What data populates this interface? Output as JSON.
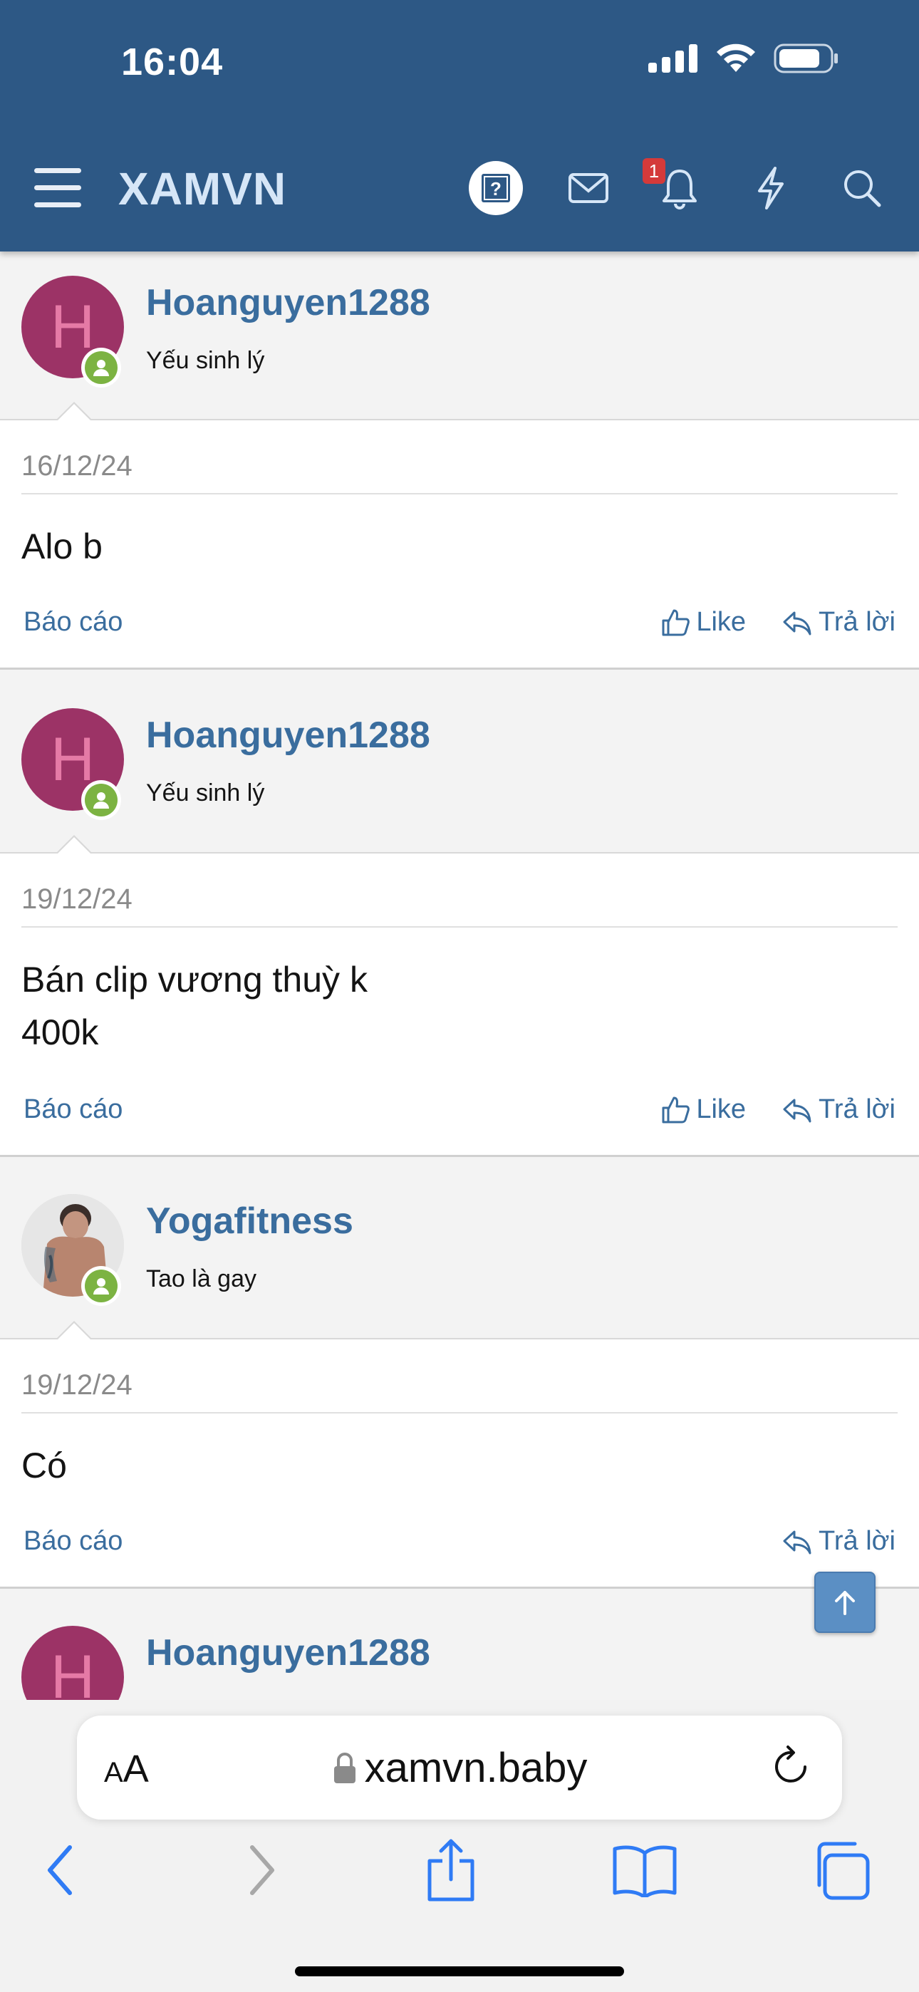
{
  "status_bar": {
    "time": "16:04"
  },
  "header": {
    "logo": "XAMVN",
    "notification_count": "1",
    "icons": [
      "menu-icon",
      "help-icon",
      "mail-icon",
      "bell-icon",
      "lightning-icon",
      "search-icon"
    ]
  },
  "posts": [
    {
      "username": "Hoanguyen1288",
      "user_title": "Yếu sinh lý",
      "avatar_letter": "H",
      "date": "16/12/24",
      "content_lines": [
        "Alo b"
      ],
      "report_label": "Báo cáo",
      "like_label": "Like",
      "reply_label": "Trả lời"
    },
    {
      "username": "Hoanguyen1288",
      "user_title": "Yếu sinh lý",
      "avatar_letter": "H",
      "date": "19/12/24",
      "content_lines": [
        "Bán clip vương thuỳ k",
        "400k"
      ],
      "report_label": "Báo cáo",
      "like_label": "Like",
      "reply_label": "Trả lời"
    },
    {
      "username": "Yogafitness",
      "user_title": "Tao là gay",
      "avatar_letter": "",
      "date": "19/12/24",
      "content_lines": [
        "Có"
      ],
      "report_label": "Báo cáo",
      "reply_label": "Trả lời"
    },
    {
      "username": "Hoanguyen1288",
      "avatar_letter": "H"
    }
  ],
  "browser": {
    "text_size_label_small": "A",
    "text_size_label_large": "A",
    "url": "xamvn.baby",
    "icons": [
      "back-icon",
      "forward-icon",
      "share-icon",
      "bookmarks-icon",
      "tabs-icon",
      "reload-icon",
      "lock-icon"
    ]
  },
  "colors": {
    "header_bg": "#2d5885",
    "link": "#3a6d9e",
    "avatar_bg": "#9c3366",
    "online": "#7cb342",
    "badge": "#d43a3a"
  }
}
